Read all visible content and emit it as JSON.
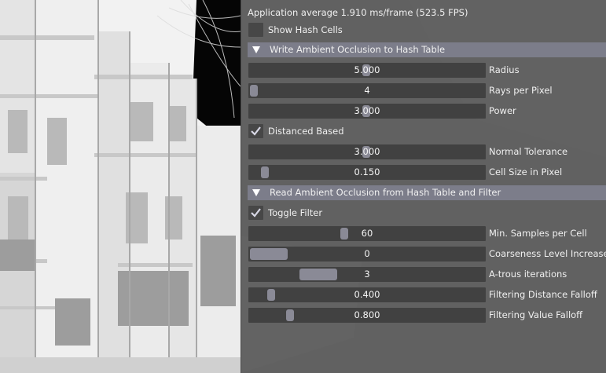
{
  "stats": {
    "text": "Application average 1.910 ms/frame (523.5 FPS)"
  },
  "show_hash_cells": {
    "label": "Show Hash Cells",
    "checked": false
  },
  "write_section": {
    "title": "Write Ambient Occlusion to Hash Table",
    "expanded": true,
    "radius": {
      "label": "Radius",
      "value": "5.000",
      "fraction": 0.495
    },
    "rays": {
      "label": "Rays per Pixel",
      "value": "4",
      "fraction": 0.0
    },
    "power": {
      "label": "Power",
      "value": "3.000",
      "fraction": 0.495
    },
    "distanced": {
      "label": "Distanced Based",
      "checked": true
    },
    "normal_tolerance": {
      "label": "Normal Tolerance",
      "value": "3.000",
      "fraction": 0.495
    },
    "cell_size": {
      "label": "Cell Size in Pixel",
      "value": "0.150",
      "fraction": 0.05
    }
  },
  "read_section": {
    "title": "Read Ambient Occlusion from Hash Table and Filter",
    "expanded": true,
    "toggle_filter": {
      "label": "Toggle Filter",
      "checked": true
    },
    "min_samples": {
      "label": "Min. Samples per Cell",
      "value": "60",
      "fraction": 0.4
    },
    "coarseness": {
      "label": "Coarseness Level Increase",
      "value": "0",
      "fraction": 0.0
    },
    "atrous": {
      "label": "A-trous iterations",
      "value": "3",
      "fraction": 0.25
    },
    "distance_falloff": {
      "label": "Filtering Distance Falloff",
      "value": "0.400",
      "fraction": 0.075
    },
    "value_falloff": {
      "label": "Filtering Value Falloff",
      "value": "0.800",
      "fraction": 0.16
    }
  },
  "colors": {
    "panel_bg": "#5c5c5c",
    "header_bg": "#7c7d8a",
    "frame_bg": "#414141",
    "grab": "#8a8a96",
    "check": "#d8d8e6"
  }
}
